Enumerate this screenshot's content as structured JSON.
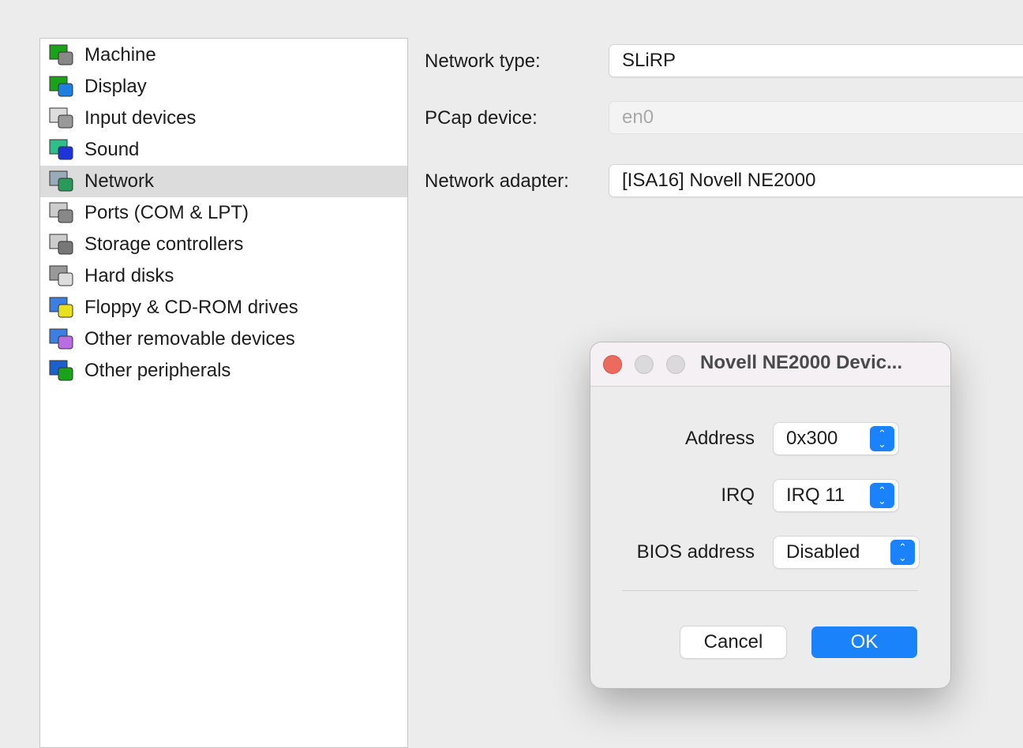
{
  "sidebar": {
    "selected": "Network",
    "items": [
      {
        "label": "Machine",
        "icon": "machine-icon"
      },
      {
        "label": "Display",
        "icon": "display-icon"
      },
      {
        "label": "Input devices",
        "icon": "input-devices-icon"
      },
      {
        "label": "Sound",
        "icon": "sound-icon"
      },
      {
        "label": "Network",
        "icon": "network-icon"
      },
      {
        "label": "Ports (COM & LPT)",
        "icon": "ports-icon"
      },
      {
        "label": "Storage controllers",
        "icon": "storage-icon"
      },
      {
        "label": "Hard disks",
        "icon": "hard-disk-icon"
      },
      {
        "label": "Floppy & CD-ROM drives",
        "icon": "floppy-cdrom-icon"
      },
      {
        "label": "Other removable devices",
        "icon": "removable-icon"
      },
      {
        "label": "Other peripherals",
        "icon": "peripherals-icon"
      }
    ]
  },
  "network": {
    "type_label": "Network type:",
    "type_value": "SLiRP",
    "pcap_label": "PCap device:",
    "pcap_value": "en0",
    "adapter_label": "Network adapter:",
    "adapter_value": "[ISA16] Novell NE2000"
  },
  "dialog": {
    "title": "Novell NE2000 Devic...",
    "address_label": "Address",
    "address_value": "0x300",
    "irq_label": "IRQ",
    "irq_value": "IRQ 11",
    "bios_label": "BIOS address",
    "bios_value": "Disabled",
    "cancel": "Cancel",
    "ok": "OK"
  },
  "colors": {
    "accent": "#1a82fb",
    "close": "#ec6a5e",
    "selection": "#dcdcdc"
  }
}
